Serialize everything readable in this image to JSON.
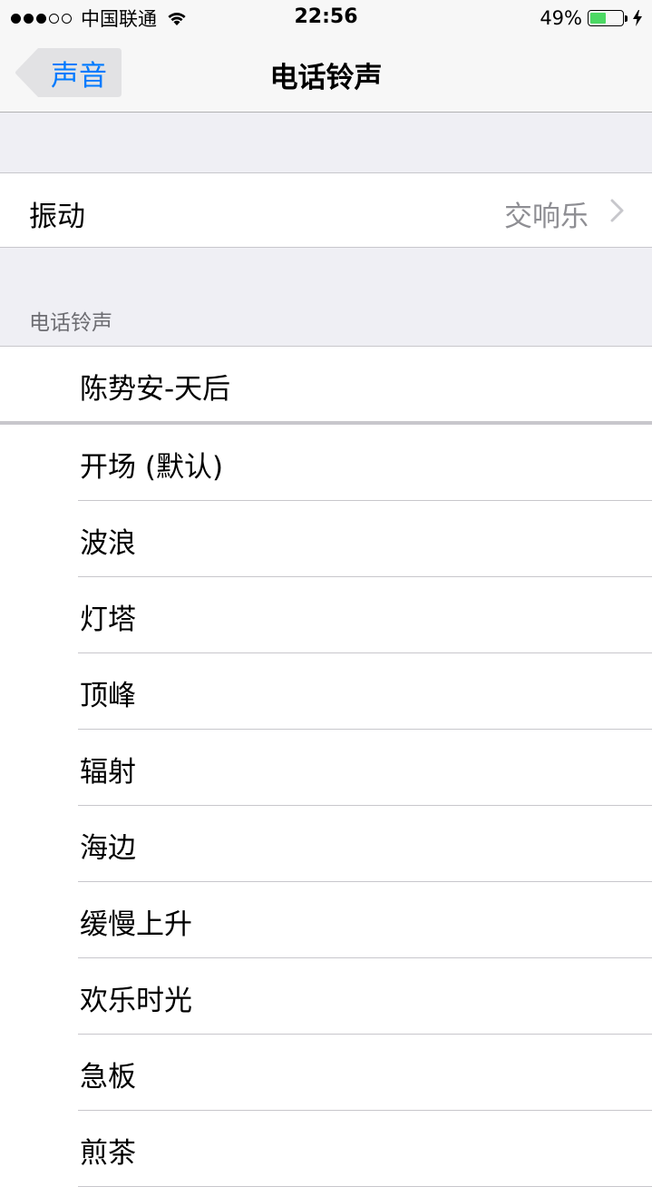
{
  "status_bar": {
    "carrier": "中国联通",
    "time": "22:56",
    "battery_percent": "49%",
    "battery_level": 0.49,
    "signal_bars": 3,
    "signal_total": 5,
    "wifi_icon": "wifi-icon",
    "charging_icon": "bolt-icon"
  },
  "nav": {
    "back_label": "声音",
    "title": "电话铃声"
  },
  "vibration": {
    "label": "振动",
    "value": "交响乐",
    "chevron_icon": "chevron-right-icon"
  },
  "section": {
    "header": "电话铃声"
  },
  "ringtones": [
    {
      "label": "陈势安-天后"
    },
    {
      "label": "开场 (默认)"
    },
    {
      "label": "波浪"
    },
    {
      "label": "灯塔"
    },
    {
      "label": "顶峰"
    },
    {
      "label": "辐射"
    },
    {
      "label": "海边"
    },
    {
      "label": "缓慢上升"
    },
    {
      "label": "欢乐时光"
    },
    {
      "label": "急板"
    },
    {
      "label": "煎茶"
    }
  ],
  "colors": {
    "accent": "#007aff",
    "battery": "#4cd964",
    "background": "#efeff4"
  }
}
